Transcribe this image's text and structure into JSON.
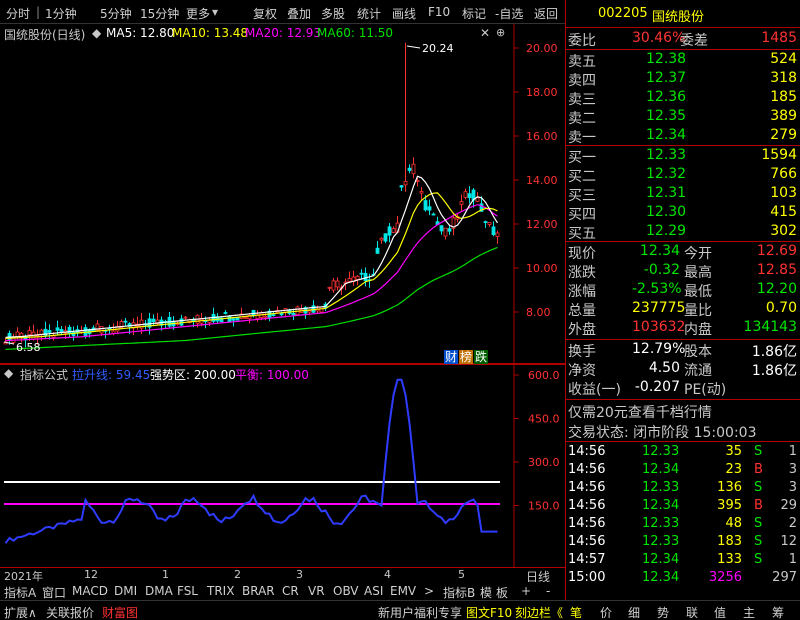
{
  "topbar": {
    "items": [
      "分时",
      "1分钟",
      "5分钟",
      "15分钟",
      "更多",
      "复权",
      "叠加",
      "多股",
      "统计",
      "画线",
      "F10",
      "标记",
      "-自选",
      "返回"
    ]
  },
  "chart": {
    "stock_label": "国统股份(日线)",
    "ma5": "MA5: 12.80",
    "ma10": "MA10: 13.48",
    "ma20": "MA20: 12.93",
    "ma60": "MA60: 11.50",
    "high_label": "20.24",
    "low_label": "6.58",
    "y_ticks": [
      "20.00",
      "18.00",
      "16.00",
      "14.00",
      "12.00",
      "10.00",
      "8.00"
    ],
    "badges": [
      "财",
      "榜",
      "跌"
    ]
  },
  "indicator": {
    "name": "指标公式",
    "l1": "拉升线: 59.45",
    "l2": "强势区: 200.00",
    "l3": "平衡: 100.00",
    "y_ticks": [
      "600.0",
      "450.0",
      "300.0",
      "150.0"
    ]
  },
  "dates": {
    "labels": [
      "2021年",
      "12",
      "1",
      "2",
      "3",
      "4",
      "5"
    ],
    "period": "日线"
  },
  "tabs": {
    "items": [
      "指标A",
      "窗口",
      "MACD",
      "DMI",
      "DMA",
      "FSL",
      "TRIX",
      "BRAR",
      "CR",
      "VR",
      "OBV",
      "ASI",
      "EMV",
      ">",
      "指标B",
      "模",
      "板",
      "+",
      "-"
    ]
  },
  "bottom": {
    "left": [
      "扩展∧",
      "关联报价",
      "财富图"
    ],
    "mid": [
      "新用户福利专享",
      "图文F10",
      "刻边栏《"
    ],
    "right": [
      "笔",
      "价",
      "细",
      "势",
      "联",
      "值",
      "主",
      "筹"
    ]
  },
  "quote": {
    "code": "002205",
    "name": "国统股份",
    "wei_bi_label": "委比",
    "wei_bi": "30.46%",
    "wei_cha_label": "委差",
    "wei_cha": "1485",
    "asks": [
      {
        "label": "卖五",
        "price": "12.38",
        "vol": "524"
      },
      {
        "label": "卖四",
        "price": "12.37",
        "vol": "318"
      },
      {
        "label": "卖三",
        "price": "12.36",
        "vol": "185"
      },
      {
        "label": "卖二",
        "price": "12.35",
        "vol": "389"
      },
      {
        "label": "卖一",
        "price": "12.34",
        "vol": "279"
      }
    ],
    "bids": [
      {
        "label": "买一",
        "price": "12.33",
        "vol": "1594"
      },
      {
        "label": "买二",
        "price": "12.32",
        "vol": "766"
      },
      {
        "label": "买三",
        "price": "12.31",
        "vol": "103"
      },
      {
        "label": "买四",
        "price": "12.30",
        "vol": "415"
      },
      {
        "label": "买五",
        "price": "12.29",
        "vol": "302"
      }
    ],
    "stats": [
      {
        "l1": "现价",
        "v1": "12.34",
        "l2": "今开",
        "v2": "12.69"
      },
      {
        "l1": "涨跌",
        "v1": "-0.32",
        "l2": "最高",
        "v2": "12.85"
      },
      {
        "l1": "涨幅",
        "v1": "-2.53%",
        "l2": "最低",
        "v2": "12.20"
      },
      {
        "l1": "总量",
        "v1": "237775",
        "l2": "量比",
        "v2": "0.70"
      },
      {
        "l1": "外盘",
        "v1": "103632",
        "l2": "内盘",
        "v2": "134143"
      }
    ],
    "stats2": [
      {
        "l1": "换手",
        "v1": "12.79%",
        "l2": "股本",
        "v2": "1.86亿"
      },
      {
        "l1": "净资",
        "v1": "4.50",
        "l2": "流通",
        "v2": "1.86亿"
      },
      {
        "l1": "收益(一)",
        "v1": "-0.207",
        "l2": "PE(动)",
        "v2": ""
      }
    ],
    "promo": "仅需20元查看千档行情",
    "status": "交易状态: 闭市阶段 15:00:03",
    "ticks": [
      {
        "t": "14:56",
        "p": "12.33",
        "v": "35",
        "d": "S",
        "n": "1"
      },
      {
        "t": "14:56",
        "p": "12.34",
        "v": "23",
        "d": "B",
        "n": "3"
      },
      {
        "t": "14:56",
        "p": "12.33",
        "v": "136",
        "d": "S",
        "n": "3"
      },
      {
        "t": "14:56",
        "p": "12.34",
        "v": "395",
        "d": "B",
        "n": "29"
      },
      {
        "t": "14:56",
        "p": "12.33",
        "v": "48",
        "d": "S",
        "n": "2"
      },
      {
        "t": "14:56",
        "p": "12.33",
        "v": "183",
        "d": "S",
        "n": "12"
      },
      {
        "t": "14:57",
        "p": "12.34",
        "v": "133",
        "d": "S",
        "n": "1"
      },
      {
        "t": "15:00",
        "p": "12.34",
        "v": "3256",
        "d": "",
        "n": "297"
      }
    ]
  }
}
